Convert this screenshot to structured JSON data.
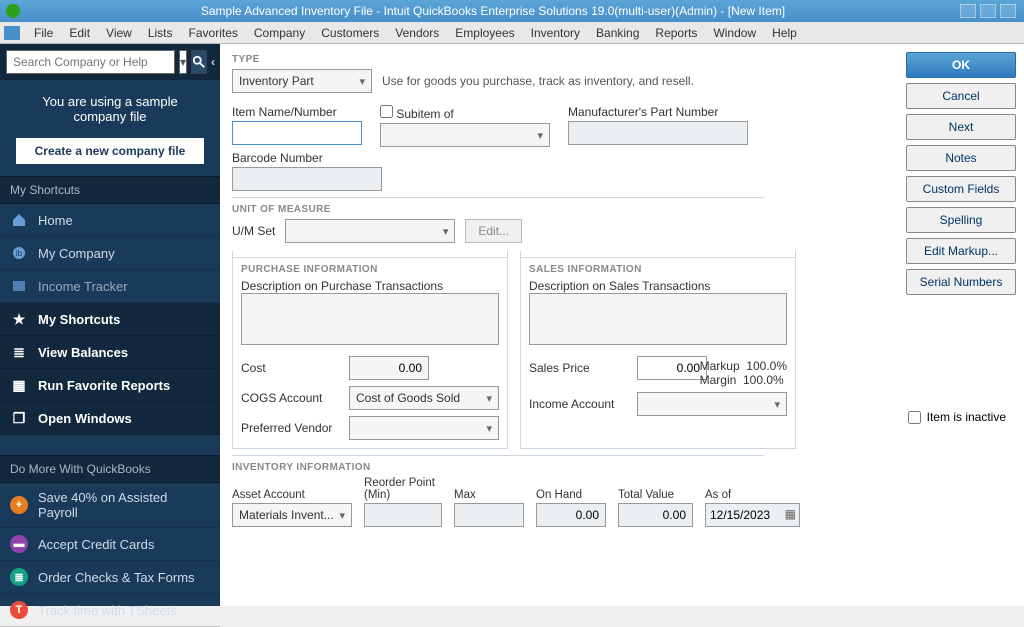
{
  "titlebar": {
    "title": "Sample Advanced Inventory File  - Intuit QuickBooks Enterprise Solutions 19.0(multi-user)(Admin) - [New Item]"
  },
  "menubar": [
    "File",
    "Edit",
    "View",
    "Lists",
    "Favorites",
    "Company",
    "Customers",
    "Vendors",
    "Employees",
    "Inventory",
    "Banking",
    "Reports",
    "Window",
    "Help"
  ],
  "sidebar": {
    "search_placeholder": "Search Company or Help",
    "sample_line1": "You are using a sample",
    "sample_line2": "company file",
    "create_company": "Create a new company file",
    "my_shortcuts_header": "My Shortcuts",
    "shortcuts": [
      {
        "label": "Home",
        "icon": "home"
      },
      {
        "label": "My Company",
        "icon": "company"
      },
      {
        "label": "Income Tracker",
        "icon": "tracker"
      }
    ],
    "panels": [
      {
        "label": "My Shortcuts",
        "icon": "star"
      },
      {
        "label": "View Balances",
        "icon": "list"
      },
      {
        "label": "Run Favorite Reports",
        "icon": "doc"
      },
      {
        "label": "Open Windows",
        "icon": "windows"
      }
    ],
    "do_more_header": "Do More With QuickBooks",
    "do_more": [
      {
        "label": "Save 40% on Assisted Payroll",
        "color": "ci-orange",
        "glyph": "+"
      },
      {
        "label": "Accept Credit Cards",
        "color": "ci-purple",
        "glyph": "▬"
      },
      {
        "label": "Order Checks & Tax Forms",
        "color": "ci-teal",
        "glyph": "≣"
      },
      {
        "label": "Track time with TSheets",
        "color": "ci-red",
        "glyph": "T"
      }
    ]
  },
  "form": {
    "type_header": "TYPE",
    "type_value": "Inventory Part",
    "type_desc": "Use for goods you purchase, track as inventory, and resell.",
    "item_name_label": "Item Name/Number",
    "subitem_label": "Subitem of",
    "mfr_part_label": "Manufacturer's Part Number",
    "barcode_label": "Barcode Number",
    "uom_header": "UNIT OF MEASURE",
    "uom_label": "U/M Set",
    "uom_edit": "Edit...",
    "purchase_header": "PURCHASE INFORMATION",
    "purchase_desc_label": "Description on Purchase Transactions",
    "cost_label": "Cost",
    "cost_value": "0.00",
    "cogs_label": "COGS Account",
    "cogs_value": "Cost of Goods Sold",
    "pref_vendor_label": "Preferred Vendor",
    "sales_header": "SALES INFORMATION",
    "sales_desc_label": "Description on Sales Transactions",
    "sales_price_label": "Sales Price",
    "sales_price_value": "0.00",
    "markup_label": "Markup",
    "markup_value": "100.0%",
    "margin_label": "Margin",
    "margin_value": "100.0%",
    "income_acct_label": "Income Account",
    "inventory_header": "INVENTORY INFORMATION",
    "asset_acct_label": "Asset Account",
    "asset_acct_value": "Materials Invent...",
    "reorder_label": "Reorder Point (Min)",
    "max_label": "Max",
    "onhand_label": "On Hand",
    "onhand_value": "0.00",
    "totalvalue_label": "Total Value",
    "totalvalue_value": "0.00",
    "asof_label": "As of",
    "asof_value": "12/15/2023",
    "inactive_label": "Item is inactive"
  },
  "buttons": {
    "ok": "OK",
    "cancel": "Cancel",
    "next": "Next",
    "notes": "Notes",
    "custom_fields": "Custom Fields",
    "spelling": "Spelling",
    "edit_markup": "Edit Markup...",
    "serial_numbers": "Serial Numbers"
  }
}
